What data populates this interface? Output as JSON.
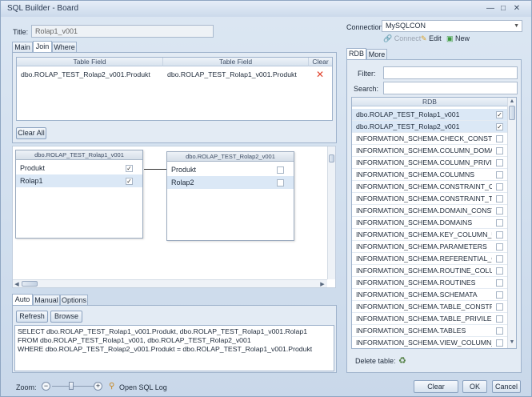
{
  "window": {
    "title": "SQL Builder - Board",
    "minimize": "—",
    "maximize": "□",
    "close": "✕"
  },
  "left": {
    "title_label": "Title:",
    "title_value": "Rolap1_v001",
    "tabs": [
      "Main",
      "Join",
      "Where"
    ],
    "join": {
      "headers": [
        "Table Field",
        "Table Field",
        "Clear"
      ],
      "rows": [
        {
          "field1": "dbo.ROLAP_TEST_Rolap2_v001.Produkt",
          "field2": "dbo.ROLAP_TEST_Rolap1_v001.Produkt",
          "clear": "✕"
        }
      ],
      "clear_all": "Clear All"
    },
    "nodes": [
      {
        "header": "dbo.ROLAP_TEST_Rolap1_v001",
        "rows": [
          {
            "label": "Produkt",
            "checked": "✓"
          },
          {
            "label": "Rolap1",
            "checked": "✓"
          }
        ]
      },
      {
        "header": "dbo.ROLAP_TEST_Rolap2_v001",
        "rows": [
          {
            "label": "Produkt",
            "checked": ""
          },
          {
            "label": "Rolap2",
            "checked": ""
          }
        ]
      }
    ],
    "bottom_tabs": [
      "Auto",
      "Manual",
      "Options"
    ],
    "refresh": "Refresh",
    "browse": "Browse",
    "sql_lines": [
      "SELECT dbo.ROLAP_TEST_Rolap1_v001.Produkt, dbo.ROLAP_TEST_Rolap1_v001.Rolap1",
      "FROM dbo.ROLAP_TEST_Rolap1_v001, dbo.ROLAP_TEST_Rolap2_v001",
      "WHERE dbo.ROLAP_TEST_Rolap2_v001.Produkt = dbo.ROLAP_TEST_Rolap1_v001.Produkt"
    ]
  },
  "right": {
    "connection_label": "Connection:",
    "connection_value": "MySQLCON",
    "connect": "Connect",
    "edit": "Edit",
    "new": "New",
    "tabs": [
      "RDB",
      "More"
    ],
    "filter_label": "Filter:",
    "search_label": "Search:",
    "list_header": "RDB",
    "tables": [
      {
        "name": "dbo.ROLAP_TEST_Rolap1_v001",
        "checked": "✓"
      },
      {
        "name": "dbo.ROLAP_TEST_Rolap2_v001",
        "checked": "✓"
      },
      {
        "name": "INFORMATION_SCHEMA.CHECK_CONSTRAINTS",
        "checked": ""
      },
      {
        "name": "INFORMATION_SCHEMA.COLUMN_DOMAIN_US",
        "checked": ""
      },
      {
        "name": "INFORMATION_SCHEMA.COLUMN_PRIVILEGES",
        "checked": ""
      },
      {
        "name": "INFORMATION_SCHEMA.COLUMNS",
        "checked": ""
      },
      {
        "name": "INFORMATION_SCHEMA.CONSTRAINT_COLUM",
        "checked": ""
      },
      {
        "name": "INFORMATION_SCHEMA.CONSTRAINT_TABLE_U",
        "checked": ""
      },
      {
        "name": "INFORMATION_SCHEMA.DOMAIN_CONSTRAIN",
        "checked": ""
      },
      {
        "name": "INFORMATION_SCHEMA.DOMAINS",
        "checked": ""
      },
      {
        "name": "INFORMATION_SCHEMA.KEY_COLUMN_USAGE",
        "checked": ""
      },
      {
        "name": "INFORMATION_SCHEMA.PARAMETERS",
        "checked": ""
      },
      {
        "name": "INFORMATION_SCHEMA.REFERENTIAL_CONSTR",
        "checked": ""
      },
      {
        "name": "INFORMATION_SCHEMA.ROUTINE_COLUMNS",
        "checked": ""
      },
      {
        "name": "INFORMATION_SCHEMA.ROUTINES",
        "checked": ""
      },
      {
        "name": "INFORMATION_SCHEMA.SCHEMATA",
        "checked": ""
      },
      {
        "name": "INFORMATION_SCHEMA.TABLE_CONSTRAINTS",
        "checked": ""
      },
      {
        "name": "INFORMATION_SCHEMA.TABLE_PRIVILEGES",
        "checked": ""
      },
      {
        "name": "INFORMATION_SCHEMA.TABLES",
        "checked": ""
      },
      {
        "name": "INFORMATION_SCHEMA.VIEW_COLUMN_USAG",
        "checked": ""
      }
    ],
    "delete_label": "Delete table:"
  },
  "footer": {
    "zoom_label": "Zoom:",
    "open_log": "Open SQL Log",
    "clear": "Clear",
    "ok": "OK",
    "cancel": "Cancel"
  },
  "colors": {
    "accent": "#3a78c8",
    "selected_row": "#dbe8f6",
    "clear_x": "#e0402a"
  }
}
